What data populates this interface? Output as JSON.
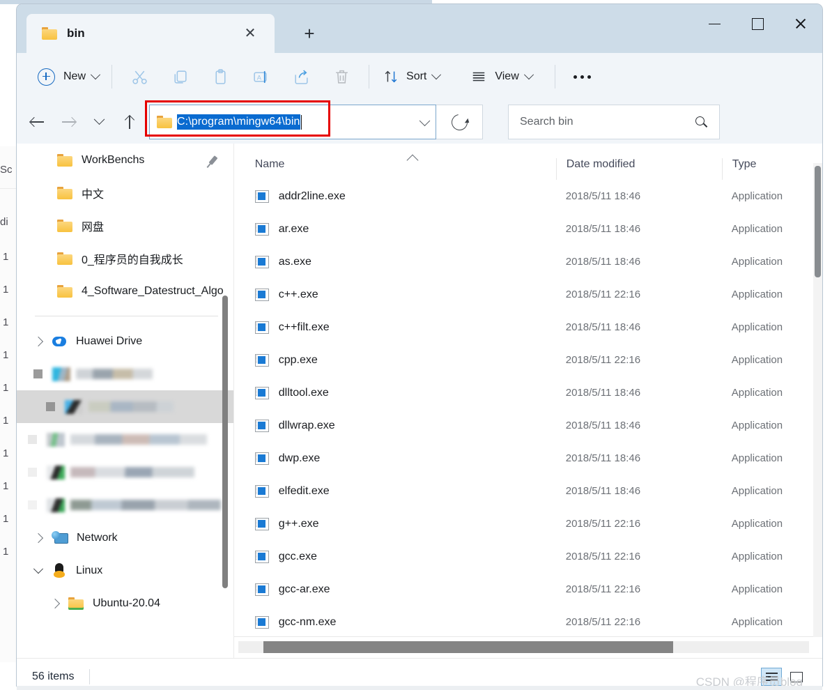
{
  "window": {
    "tab_title": "bin",
    "close_tab_glyph": "✕",
    "new_tab_glyph": "+"
  },
  "toolbar": {
    "new_label": "New",
    "cut_icon": "scissors-icon",
    "copy_icon": "copy-icon",
    "paste_icon": "paste-icon",
    "rename_icon": "rename-icon",
    "share_icon": "share-icon",
    "delete_icon": "trash-icon",
    "sort_label": "Sort",
    "view_label": "View",
    "more_icon": "ellipsis-icon"
  },
  "address": {
    "path": "C:\\program\\mingw64\\bin",
    "highlight_color": "#0a6bd0",
    "annotation_color": "#e60000"
  },
  "search": {
    "placeholder": "Search bin"
  },
  "sidebar": {
    "quick_items": [
      {
        "label": "WorkBenchs",
        "pinned": true
      },
      {
        "label": "中文",
        "pinned": false
      },
      {
        "label": "网盘",
        "pinned": false
      },
      {
        "label": "0_程序员的自我成长",
        "pinned": false
      },
      {
        "label": "4_Software_Datestruct_Algo",
        "pinned": false
      }
    ],
    "drive_label": "Huawei Drive",
    "network_label": "Network",
    "linux_label": "Linux",
    "ubuntu_label": "Ubuntu-20.04",
    "redacted_count": 5
  },
  "columns": {
    "name": "Name",
    "date_modified": "Date modified",
    "type": "Type",
    "sort_direction": "ascending"
  },
  "files": [
    {
      "name": "addr2line.exe",
      "date": "2018/5/11 18:46",
      "type": "Application"
    },
    {
      "name": "ar.exe",
      "date": "2018/5/11 18:46",
      "type": "Application"
    },
    {
      "name": "as.exe",
      "date": "2018/5/11 18:46",
      "type": "Application"
    },
    {
      "name": "c++.exe",
      "date": "2018/5/11 22:16",
      "type": "Application"
    },
    {
      "name": "c++filt.exe",
      "date": "2018/5/11 18:46",
      "type": "Application"
    },
    {
      "name": "cpp.exe",
      "date": "2018/5/11 22:16",
      "type": "Application"
    },
    {
      "name": "dlltool.exe",
      "date": "2018/5/11 18:46",
      "type": "Application"
    },
    {
      "name": "dllwrap.exe",
      "date": "2018/5/11 18:46",
      "type": "Application"
    },
    {
      "name": "dwp.exe",
      "date": "2018/5/11 18:46",
      "type": "Application"
    },
    {
      "name": "elfedit.exe",
      "date": "2018/5/11 18:46",
      "type": "Application"
    },
    {
      "name": "g++.exe",
      "date": "2018/5/11 22:16",
      "type": "Application"
    },
    {
      "name": "gcc.exe",
      "date": "2018/5/11 22:16",
      "type": "Application"
    },
    {
      "name": "gcc-ar.exe",
      "date": "2018/5/11 22:16",
      "type": "Application"
    },
    {
      "name": "gcc-nm.exe",
      "date": "2018/5/11 22:16",
      "type": "Application"
    }
  ],
  "status": {
    "item_count": "56 items"
  },
  "watermark": {
    "text": "CSDN @程序员blog"
  },
  "background": {
    "fragments": [
      "Sс",
      "di",
      "1",
      "1",
      "1",
      "1",
      "1",
      "1",
      "1",
      "1",
      "1",
      "1"
    ]
  }
}
